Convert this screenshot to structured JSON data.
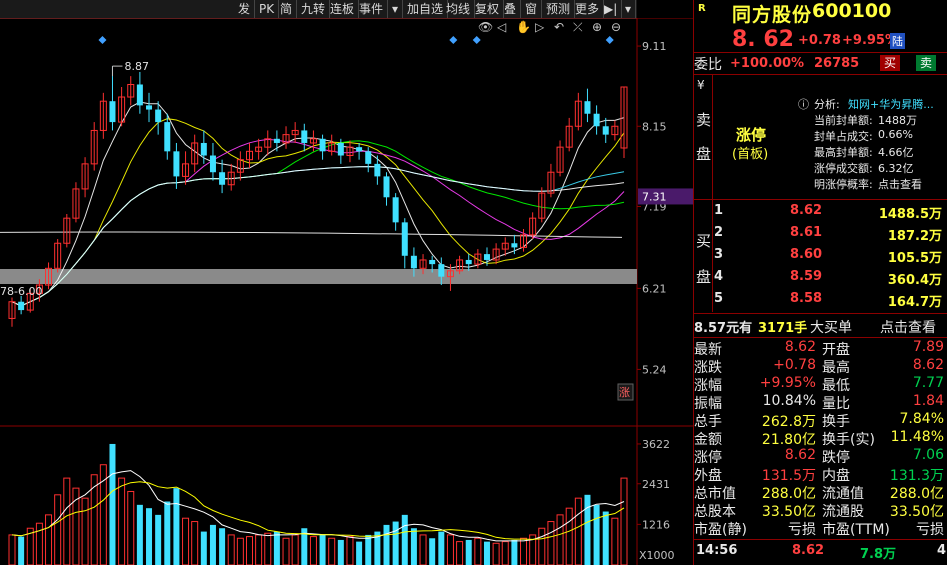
{
  "toolbar": {
    "items": [
      "发",
      "PK",
      "简",
      "九转",
      "连板",
      "事件",
      "▾",
      "加自选",
      "均线",
      "复权",
      "叠",
      "窗",
      "预测",
      "更多",
      "▶|",
      "▾"
    ]
  },
  "chart_icons": [
    "👁",
    "◁",
    "✋",
    "▷",
    "↶",
    "⤫",
    "⊕",
    "⊖"
  ],
  "chart_data": [
    {
      "type": "candlestick",
      "y_ticks": [
        "9.11",
        "8.15",
        "7.19",
        "6.21",
        "5.24"
      ],
      "current_price_label": "7.31",
      "peak_annotation": "8.87",
      "low_annotation": "78-6.00",
      "corner_badge": "涨",
      "candles": [
        [
          5.85,
          6.05,
          5.75,
          6.1
        ],
        [
          6.05,
          5.95,
          5.9,
          6.12
        ],
        [
          5.95,
          6.15,
          5.92,
          6.2
        ],
        [
          6.15,
          6.25,
          6.05,
          6.32
        ],
        [
          6.25,
          6.45,
          6.2,
          6.52
        ],
        [
          6.45,
          6.75,
          6.4,
          6.8
        ],
        [
          6.75,
          7.05,
          6.7,
          7.1
        ],
        [
          7.05,
          7.4,
          7.0,
          7.48
        ],
        [
          7.4,
          7.7,
          7.3,
          7.78
        ],
        [
          7.7,
          8.1,
          7.62,
          8.2
        ],
        [
          8.1,
          8.45,
          8.0,
          8.55
        ],
        [
          8.45,
          8.2,
          8.1,
          8.87
        ],
        [
          8.2,
          8.5,
          8.15,
          8.62
        ],
        [
          8.5,
          8.65,
          8.4,
          8.75
        ],
        [
          8.65,
          8.4,
          8.3,
          8.8
        ],
        [
          8.4,
          8.35,
          8.2,
          8.55
        ],
        [
          8.35,
          8.2,
          8.05,
          8.45
        ],
        [
          8.2,
          7.85,
          7.75,
          8.3
        ],
        [
          7.85,
          7.55,
          7.4,
          7.95
        ],
        [
          7.55,
          7.7,
          7.45,
          7.85
        ],
        [
          7.7,
          7.95,
          7.6,
          8.05
        ],
        [
          7.95,
          7.8,
          7.7,
          8.1
        ],
        [
          7.8,
          7.6,
          7.5,
          7.95
        ],
        [
          7.6,
          7.45,
          7.35,
          7.75
        ],
        [
          7.45,
          7.6,
          7.38,
          7.7
        ],
        [
          7.6,
          7.75,
          7.5,
          7.85
        ],
        [
          7.75,
          7.85,
          7.65,
          7.95
        ],
        [
          7.85,
          7.9,
          7.75,
          8.0
        ],
        [
          7.9,
          8.0,
          7.8,
          8.1
        ],
        [
          8.0,
          7.95,
          7.85,
          8.1
        ],
        [
          7.95,
          8.05,
          7.88,
          8.15
        ],
        [
          8.05,
          8.1,
          7.95,
          8.2
        ],
        [
          8.1,
          7.95,
          7.85,
          8.18
        ],
        [
          7.95,
          8.0,
          7.85,
          8.1
        ],
        [
          8.0,
          7.85,
          7.75,
          8.05
        ],
        [
          7.85,
          7.95,
          7.8,
          8.05
        ],
        [
          7.95,
          7.8,
          7.7,
          8.0
        ],
        [
          7.8,
          7.9,
          7.72,
          7.98
        ],
        [
          7.9,
          7.85,
          7.75,
          7.95
        ],
        [
          7.85,
          7.7,
          7.6,
          7.9
        ],
        [
          7.7,
          7.55,
          7.45,
          7.8
        ],
        [
          7.55,
          7.3,
          7.2,
          7.6
        ],
        [
          7.3,
          7.0,
          6.9,
          7.35
        ],
        [
          7.0,
          6.6,
          6.45,
          7.05
        ],
        [
          6.6,
          6.45,
          6.35,
          6.7
        ],
        [
          6.45,
          6.55,
          6.38,
          6.62
        ],
        [
          6.55,
          6.5,
          6.4,
          6.6
        ],
        [
          6.5,
          6.35,
          6.25,
          6.58
        ],
        [
          6.35,
          6.42,
          6.18,
          6.5
        ],
        [
          6.42,
          6.55,
          6.38,
          6.6
        ],
        [
          6.55,
          6.5,
          6.42,
          6.62
        ],
        [
          6.5,
          6.62,
          6.45,
          6.68
        ],
        [
          6.62,
          6.55,
          6.48,
          6.7
        ],
        [
          6.55,
          6.68,
          6.5,
          6.75
        ],
        [
          6.68,
          6.75,
          6.6,
          6.82
        ],
        [
          6.75,
          6.7,
          6.62,
          6.85
        ],
        [
          6.7,
          6.85,
          6.65,
          6.92
        ],
        [
          6.85,
          7.05,
          6.8,
          7.12
        ],
        [
          7.05,
          7.35,
          7.0,
          7.42
        ],
        [
          7.35,
          7.6,
          7.3,
          7.7
        ],
        [
          7.6,
          7.9,
          7.55,
          7.98
        ],
        [
          7.9,
          8.15,
          7.85,
          8.25
        ],
        [
          8.15,
          8.45,
          8.1,
          8.55
        ],
        [
          8.45,
          8.3,
          8.2,
          8.6
        ],
        [
          8.3,
          8.15,
          8.05,
          8.4
        ],
        [
          8.15,
          8.05,
          7.95,
          8.25
        ],
        [
          8.05,
          8.15,
          7.98,
          8.22
        ],
        [
          7.89,
          8.62,
          7.77,
          8.62
        ]
      ],
      "ma_colors": [
        "#ffffff",
        "#ffff00",
        "#ff40ff",
        "#00ff00",
        "#40e0ff",
        "#ffffff"
      ],
      "volume_y_ticks": [
        "3622",
        "2431",
        "1216"
      ],
      "volume_unit": "X1000",
      "volumes": [
        900,
        850,
        1100,
        1250,
        1500,
        2100,
        2600,
        2300,
        2000,
        2700,
        3000,
        3622,
        2600,
        2200,
        1800,
        1700,
        1500,
        1900,
        2300,
        1400,
        1300,
        1000,
        1200,
        1100,
        900,
        800,
        850,
        900,
        950,
        1000,
        800,
        900,
        1100,
        850,
        900,
        800,
        750,
        850,
        700,
        900,
        1000,
        1200,
        1300,
        1500,
        1100,
        900,
        800,
        1000,
        900,
        700,
        750,
        800,
        700,
        650,
        700,
        750,
        800,
        900,
        1100,
        1300,
        1500,
        1700,
        2000,
        2100,
        1800,
        1600,
        1400,
        2600
      ]
    }
  ],
  "quote": {
    "badge": "R",
    "name": "同方股份",
    "code": "600100",
    "price": "8. 62",
    "change": "+0.78",
    "pct": "+9.95%",
    "market_badge": "陆",
    "weibi_label": "委比",
    "weibi_value": "+100.00%",
    "weicha_value": "26785",
    "buy_btn": "买",
    "sell_btn": "卖"
  },
  "sell_panel": {
    "label_chars": [
      "¥",
      "卖",
      "盘"
    ],
    "limit_status": "涨停",
    "limit_sub": "(首板)",
    "info_icon": "ⓘ",
    "analysis_label": "分析:",
    "analysis_link": "知网+华为昇腾...",
    "lines": [
      {
        "k": "当前封单额:",
        "v": "1488万"
      },
      {
        "k": "封单占成交:",
        "v": "0.66%"
      },
      {
        "k": "最高封单额:",
        "v": "4.66亿"
      },
      {
        "k": "涨停成交额:",
        "v": "6.32亿"
      },
      {
        "k": "明涨停概率:",
        "v": "点击查看"
      }
    ]
  },
  "buy_panel": {
    "label_chars": [
      "买",
      "盘"
    ],
    "levels": [
      {
        "n": "1",
        "price": "8.62",
        "vol": "1488.5万"
      },
      {
        "n": "2",
        "price": "8.61",
        "vol": "187.2万"
      },
      {
        "n": "3",
        "price": "8.60",
        "vol": "105.5万"
      },
      {
        "n": "4",
        "price": "8.59",
        "vol": "360.4万"
      },
      {
        "n": "5",
        "price": "8.58",
        "vol": "164.7万"
      }
    ]
  },
  "big_order": {
    "price": "8.57元有",
    "vol": "3171手",
    "label": "大买单",
    "link": "点击查看"
  },
  "stats": [
    {
      "k1": "最新",
      "v1": "8.62",
      "c1": "red",
      "k2": "开盘",
      "v2": "7.89",
      "c2": "red"
    },
    {
      "k1": "涨跌",
      "v1": "+0.78",
      "c1": "red",
      "k2": "最高",
      "v2": "8.62",
      "c2": "red"
    },
    {
      "k1": "涨幅",
      "v1": "+9.95%",
      "c1": "red",
      "k2": "最低",
      "v2": "7.77",
      "c2": "green"
    },
    {
      "k1": "振幅",
      "v1": "10.84%",
      "c1": "white",
      "k2": "量比",
      "v2": "1.84",
      "c2": "red"
    },
    {
      "k1": "总手",
      "v1": "262.8万",
      "c1": "yellow",
      "k2": "换手",
      "v2": "7.84%",
      "c2": "yellow"
    },
    {
      "k1": "金额",
      "v1": "21.80亿",
      "c1": "yellow",
      "k2": "换手(实)",
      "v2": "11.48%",
      "c2": "yellow"
    },
    {
      "k1": "涨停",
      "v1": "8.62",
      "c1": "red",
      "k2": "跌停",
      "v2": "7.06",
      "c2": "green"
    },
    {
      "k1": "外盘",
      "v1": "131.5万",
      "c1": "red",
      "k2": "内盘",
      "v2": "131.3万",
      "c2": "green"
    },
    {
      "k1": "总市值",
      "v1": "288.0亿",
      "c1": "yellow",
      "k2": "流通值",
      "v2": "288.0亿",
      "c2": "yellow"
    },
    {
      "k1": "总股本",
      "v1": "33.50亿",
      "c1": "yellow",
      "k2": "流通股",
      "v2": "33.50亿",
      "c2": "yellow"
    },
    {
      "k1": "市盈(静)",
      "v1": "亏损",
      "c1": "white",
      "k2": "市盈(TTM)",
      "v2": "亏损",
      "c2": "white"
    }
  ],
  "tick": {
    "time": "14:56",
    "price": "8.62",
    "vol": "7.8万",
    "count": "4"
  }
}
